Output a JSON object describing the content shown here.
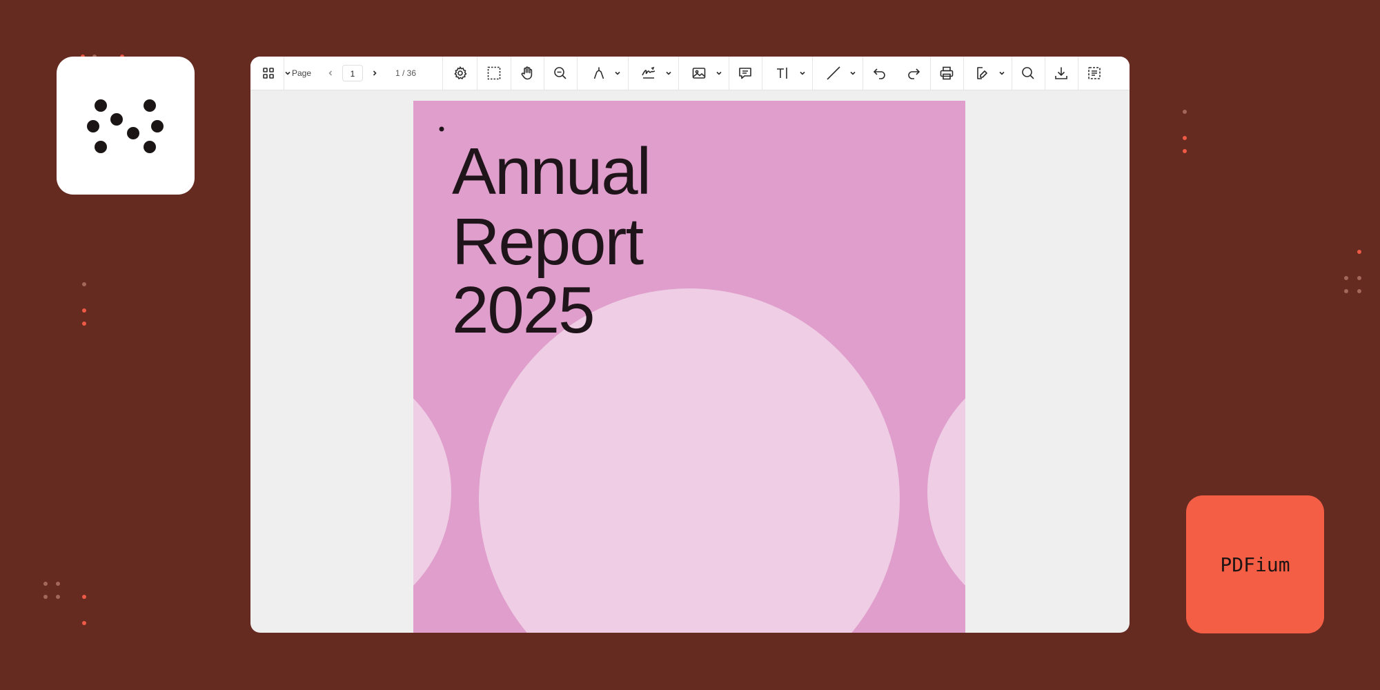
{
  "brand": {
    "engine_label": "PDFium",
    "colors": {
      "background": "#652b21",
      "accent": "#f45e45",
      "page": "#df9ecb",
      "circle": "#efcde5"
    }
  },
  "toolbar": {
    "page_label": "Page",
    "current_page": "1",
    "page_count": "1 / 36",
    "icons": [
      "thumbnails-icon",
      "settings-icon",
      "marquee-select-icon",
      "pan-hand-icon",
      "zoom-out-icon",
      "pen-icon",
      "signature-icon",
      "image-icon",
      "comment-icon",
      "text-icon",
      "line-icon",
      "undo-icon",
      "redo-icon",
      "print-icon",
      "edit-form-icon",
      "search-icon",
      "download-icon",
      "document-outline-icon"
    ]
  },
  "document": {
    "title_lines": [
      "Annual",
      "Report"
    ],
    "year": "2025"
  }
}
